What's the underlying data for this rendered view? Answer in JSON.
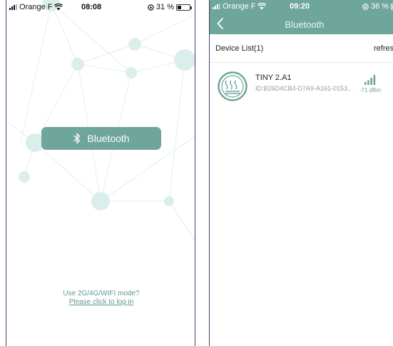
{
  "left_screen": {
    "status_bar": {
      "carrier": "Orange F",
      "time": "08:08",
      "battery": "31 %",
      "battery_level": 0.31
    },
    "bluetooth_button": {
      "label": "Bluetooth",
      "icon": "bluetooth-icon"
    },
    "login_hint": {
      "text": "Use 2G/4G/WIFI mode?",
      "link": "Please click to log in"
    }
  },
  "right_screen": {
    "status_bar": {
      "carrier": "Orange F",
      "time": "09:20",
      "battery": "36 %",
      "battery_level": 0.36
    },
    "header": {
      "title": "Bluetooth",
      "back_icon": "chevron-left-icon"
    },
    "device_list": {
      "title": "Device List(1)",
      "refresh_label": "refresh",
      "devices": [
        {
          "name": "TINY 2.A1",
          "id": "ID:B26D4CB4-D7A9-A161-0153...",
          "rssi": "-71 dBm",
          "icon": "heater-icon",
          "signal_icon": "signal-strength-icon"
        }
      ]
    }
  },
  "colors": {
    "accent": "#6ea69b",
    "network_node": "#dceeeb",
    "divider": "#4a3b6b"
  }
}
